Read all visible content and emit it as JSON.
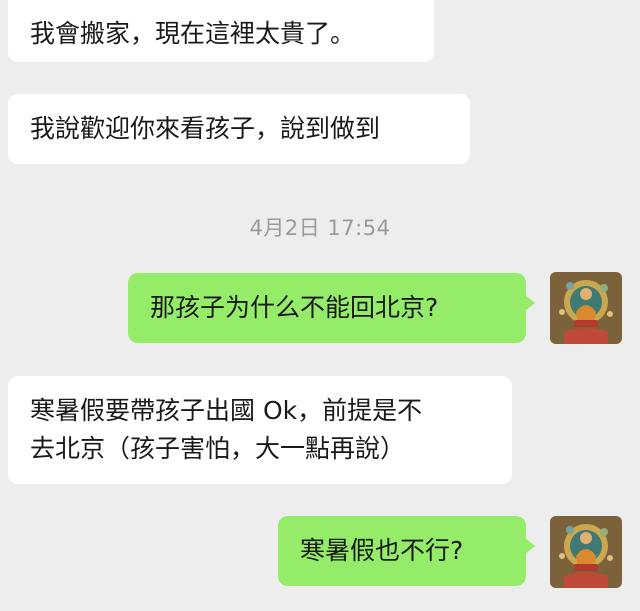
{
  "chat": {
    "messages": [
      {
        "side": "in",
        "text": "我會搬家，現在這裡太貴了。"
      },
      {
        "side": "in",
        "text": "我說歡迎你來看孩子，說到做到"
      },
      {
        "side": "out",
        "text": "那孩子为什么不能回北京?"
      },
      {
        "side": "in",
        "lines": [
          "寒暑假要帶孩子出國 Ok，前提是不",
          "去北京（孩子害怕，大一點再說）"
        ]
      },
      {
        "side": "out",
        "text": "寒暑假也不行?"
      }
    ],
    "timestamp": "4月2日 17:54"
  },
  "colors": {
    "background": "#ededed",
    "incoming_bubble": "#ffffff",
    "outgoing_bubble": "#95ec69",
    "timestamp_text": "#9a9a9a"
  },
  "avatar": {
    "icon": "thangka-deity-avatar-icon"
  }
}
